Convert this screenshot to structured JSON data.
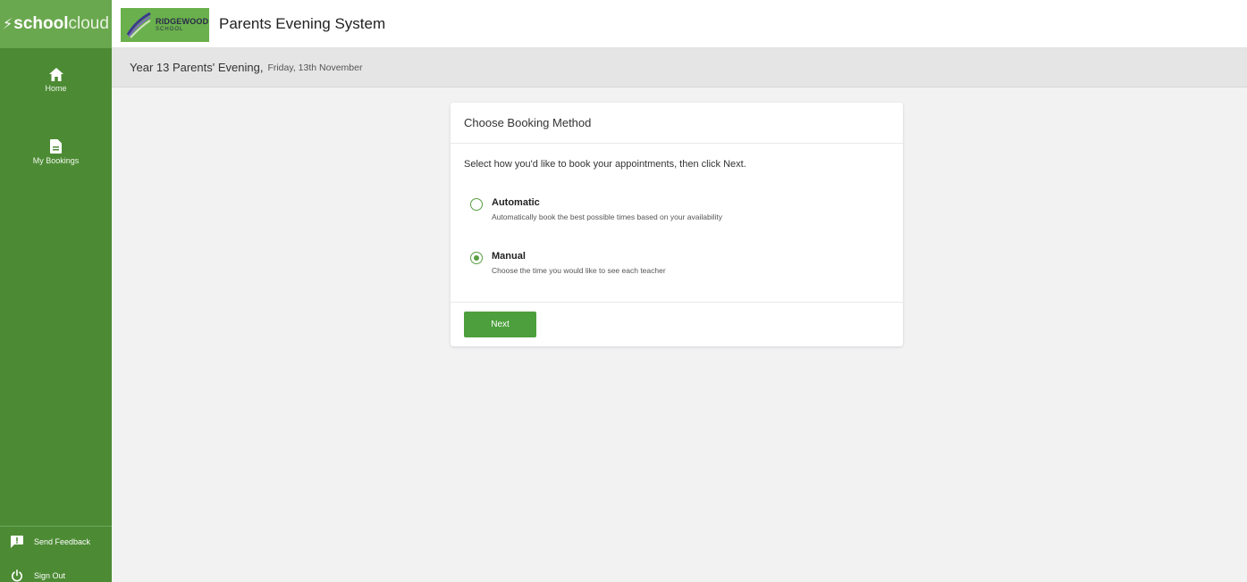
{
  "brand": {
    "bolt": "⚡",
    "part1": "school",
    "part2": "cloud"
  },
  "school": {
    "line1": "RIDGEWOOD",
    "line2": "SCHOOL"
  },
  "app": {
    "title": "Parents Evening System"
  },
  "sidebar": {
    "items": [
      {
        "label": "Home",
        "icon": "home-icon"
      },
      {
        "label": "My Bookings",
        "icon": "document-icon"
      }
    ],
    "footer": [
      {
        "label": "Send Feedback",
        "icon": "feedback-icon"
      },
      {
        "label": "Sign Out",
        "icon": "power-icon"
      }
    ]
  },
  "event": {
    "name": "Year 13 Parents' Evening,",
    "date": "Friday, 13th November"
  },
  "booking": {
    "title": "Choose Booking Method",
    "instruction": "Select how you'd like to book your appointments, then click Next.",
    "options": [
      {
        "label": "Automatic",
        "description": "Automatically book the best possible times based on your availability",
        "selected": false
      },
      {
        "label": "Manual",
        "description": "Choose the time you would like to see each teacher",
        "selected": true
      }
    ],
    "next_label": "Next"
  },
  "colors": {
    "brand": "#6aa84f",
    "sidebar": "#4c8b34",
    "accent": "#4c9f3c"
  }
}
